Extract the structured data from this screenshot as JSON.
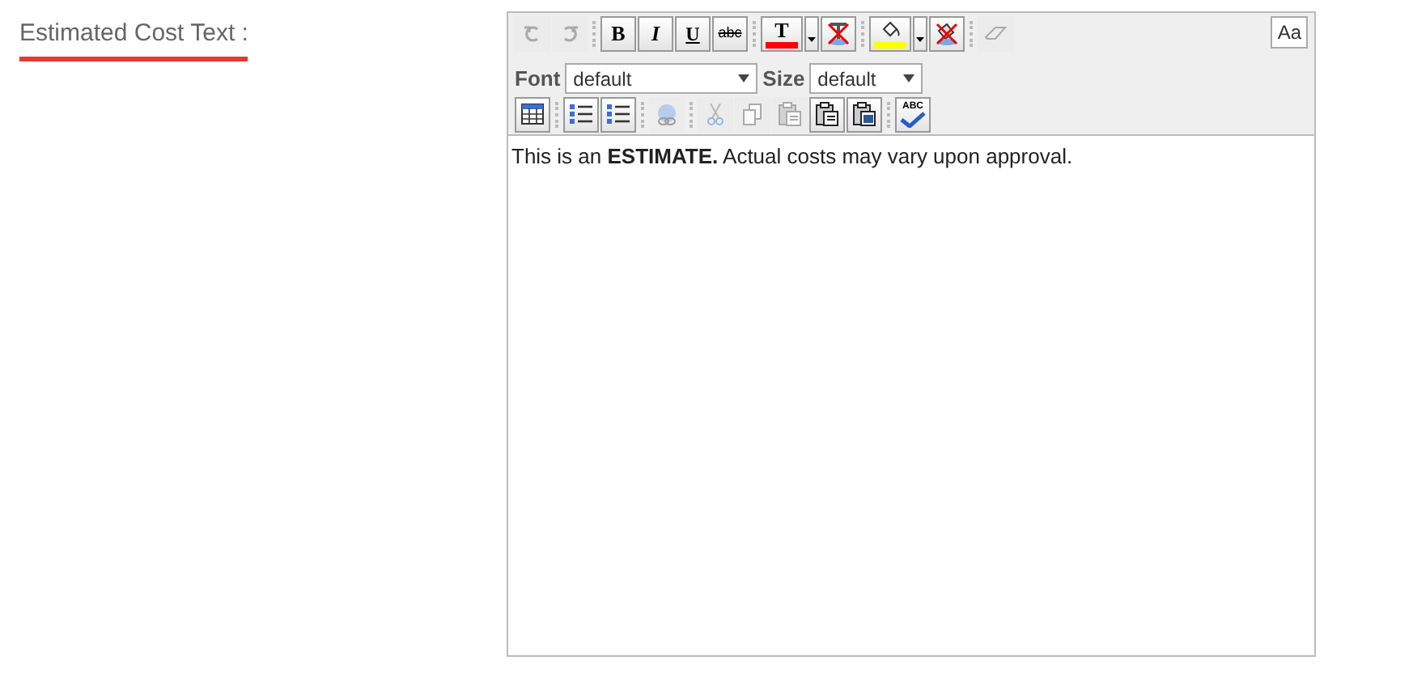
{
  "field_label": "Estimated Cost Text :",
  "editor": {
    "style_button": "Aa",
    "toolbar_1": [
      {
        "kind": "undo",
        "disabled": true
      },
      {
        "kind": "redo",
        "disabled": true
      },
      {
        "kind": "separator"
      },
      {
        "kind": "bold",
        "label": "B",
        "disabled": false
      },
      {
        "kind": "italic",
        "label": "I",
        "disabled": false
      },
      {
        "kind": "underline",
        "label": "U",
        "disabled": false
      },
      {
        "kind": "strike",
        "label": "abc",
        "disabled": false
      },
      {
        "kind": "separator"
      },
      {
        "kind": "text-color",
        "label": "T",
        "color": "#ff0000",
        "disabled": false
      },
      {
        "kind": "dropdown",
        "disabled": false
      },
      {
        "kind": "remove-text-color",
        "disabled": false
      },
      {
        "kind": "separator"
      },
      {
        "kind": "fill-color",
        "color": "#ffff00",
        "disabled": false
      },
      {
        "kind": "dropdown",
        "disabled": false
      },
      {
        "kind": "remove-fill-color",
        "disabled": false
      },
      {
        "kind": "separator"
      },
      {
        "kind": "eraser",
        "disabled": true
      }
    ],
    "font": {
      "label": "Font",
      "value": "default"
    },
    "size": {
      "label": "Size",
      "value": "default"
    },
    "toolbar_3": [
      {
        "kind": "table",
        "disabled": false
      },
      {
        "kind": "separator"
      },
      {
        "kind": "bullet-list",
        "disabled": false
      },
      {
        "kind": "numbered-list",
        "disabled": false
      },
      {
        "kind": "separator"
      },
      {
        "kind": "link",
        "disabled": true
      },
      {
        "kind": "separator"
      },
      {
        "kind": "cut",
        "disabled": true
      },
      {
        "kind": "copy",
        "disabled": true
      },
      {
        "kind": "paste",
        "disabled": true
      },
      {
        "kind": "paste-text",
        "disabled": false
      },
      {
        "kind": "paste-word",
        "disabled": false
      },
      {
        "kind": "separator"
      },
      {
        "kind": "spellcheck",
        "label": "ABC",
        "disabled": false
      }
    ],
    "content": "This is an **ESTIMATE.** Actual costs may vary upon approval."
  }
}
